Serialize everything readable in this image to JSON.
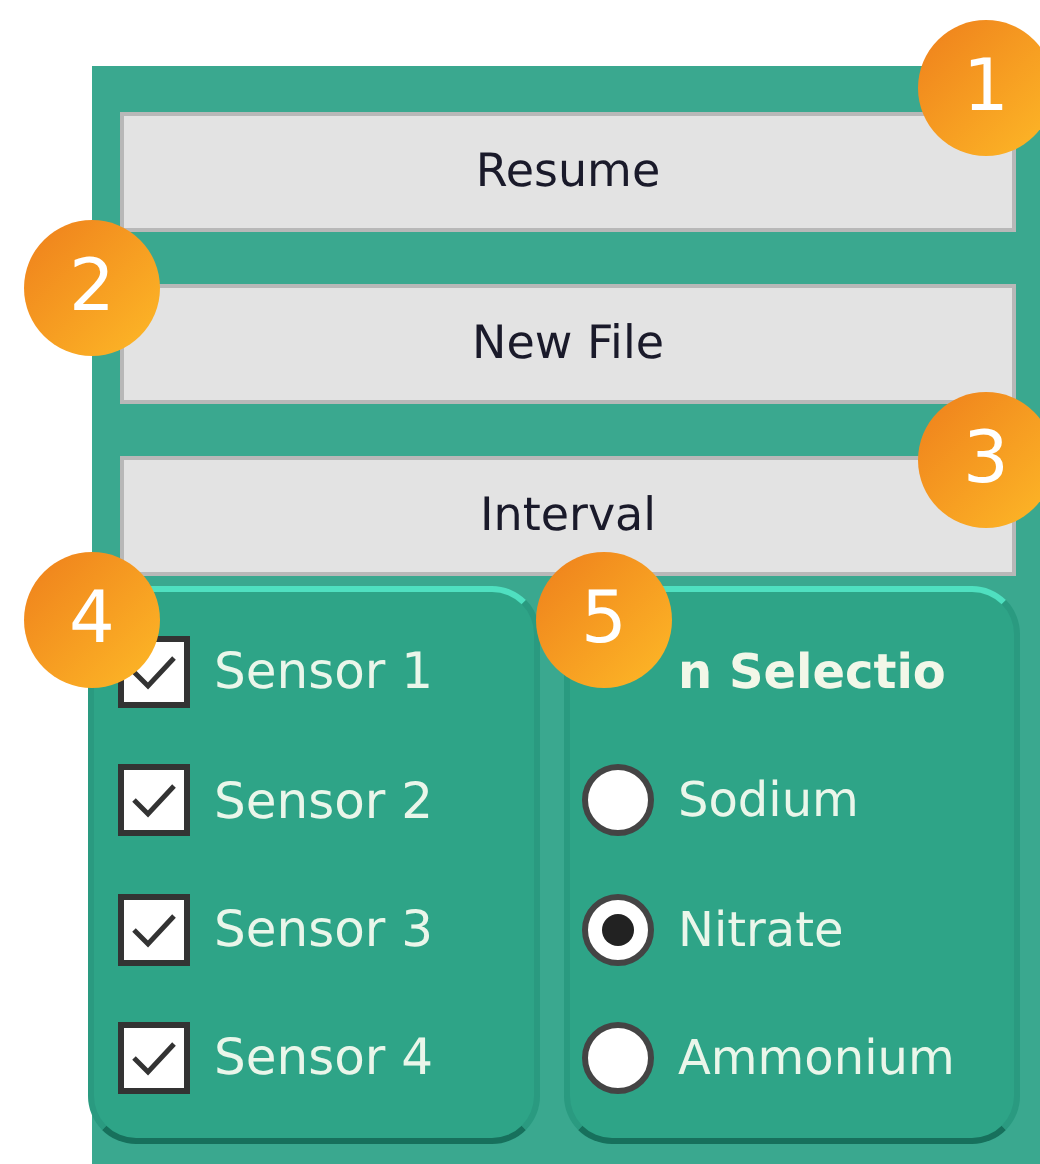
{
  "buttons": [
    {
      "label": "Resume"
    },
    {
      "label": "New File"
    },
    {
      "label": "Interval"
    }
  ],
  "sensors": [
    {
      "label": "Sensor 1",
      "checked": true
    },
    {
      "label": "Sensor 2",
      "checked": true
    },
    {
      "label": "Sensor 3",
      "checked": true
    },
    {
      "label": "Sensor 4",
      "checked": true
    }
  ],
  "ion_selection": {
    "title": "n Selectio",
    "options": [
      {
        "label": "Sodium",
        "selected": false
      },
      {
        "label": "Nitrate",
        "selected": true
      },
      {
        "label": "Ammonium",
        "selected": false
      }
    ]
  },
  "callouts": [
    {
      "number": "1"
    },
    {
      "number": "2"
    },
    {
      "number": "3"
    },
    {
      "number": "4"
    },
    {
      "number": "5"
    }
  ]
}
